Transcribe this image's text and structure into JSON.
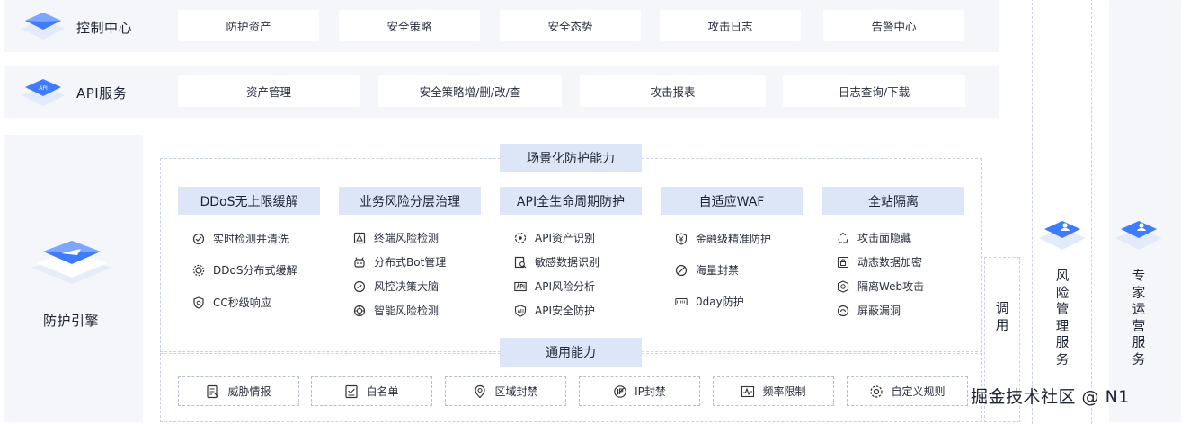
{
  "control_center": {
    "label": "控制中心",
    "items": [
      "防护资产",
      "安全策略",
      "安全态势",
      "攻击日志",
      "告警中心"
    ]
  },
  "api_service": {
    "label": "API服务",
    "cube_text": "API",
    "items": [
      "资产管理",
      "安全策略增/删/改/查",
      "攻击报表",
      "日志查询/下载"
    ]
  },
  "engine": {
    "label": "防护引擎"
  },
  "scenario": {
    "title": "场景化防护能力",
    "columns": [
      {
        "title": "DDoS无上限缓解",
        "items": [
          {
            "icon": "monitor-check-icon",
            "label": "实时检测并清洗"
          },
          {
            "icon": "gear-icon",
            "label": "DDoS分布式缓解"
          },
          {
            "icon": "shield-icon",
            "label": "CC秒级响应"
          }
        ]
      },
      {
        "title": "业务风险分层治理",
        "items": [
          {
            "icon": "warning-terminal-icon",
            "label": "终端风险检测"
          },
          {
            "icon": "bot-icon",
            "label": "分布式Bot管理"
          },
          {
            "icon": "brain-icon",
            "label": "风控决策大脑"
          },
          {
            "icon": "smart-detect-icon",
            "label": "智能风险检测"
          }
        ]
      },
      {
        "title": "API全生命周期防护",
        "items": [
          {
            "icon": "api-asset-icon",
            "label": "API资产识别"
          },
          {
            "icon": "data-scan-icon",
            "label": "敏感数据识别"
          },
          {
            "icon": "api-box-icon",
            "label": "API风险分析"
          },
          {
            "icon": "api-shield-icon",
            "label": "API安全防护"
          }
        ]
      },
      {
        "title": "自适应WAF",
        "items": [
          {
            "icon": "finance-shield-icon",
            "label": "金融级精准防护"
          },
          {
            "icon": "ban-icon",
            "label": "海量封禁"
          },
          {
            "icon": "zero-day-icon",
            "label": "0day防护"
          }
        ]
      },
      {
        "title": "全站隔离",
        "items": [
          {
            "icon": "recycle-icon",
            "label": "攻击面隐藏"
          },
          {
            "icon": "lock-doc-icon",
            "label": "动态数据加密"
          },
          {
            "icon": "isolate-icon",
            "label": "隔离Web攻击"
          },
          {
            "icon": "patch-icon",
            "label": "屏蔽漏洞"
          }
        ]
      }
    ]
  },
  "common": {
    "title": "通用能力",
    "items": [
      {
        "icon": "intel-icon",
        "label": "威胁情报"
      },
      {
        "icon": "whitelist-icon",
        "label": "白名单"
      },
      {
        "icon": "region-icon",
        "label": "区域封禁"
      },
      {
        "icon": "ip-icon",
        "label": "IP封禁"
      },
      {
        "icon": "rate-icon",
        "label": "频率限制"
      },
      {
        "icon": "custom-rule-icon",
        "label": "自定义规则"
      }
    ]
  },
  "side": {
    "call_label": "调用",
    "risk_service": "风险管理服务",
    "expert_service": "专家运营服务"
  },
  "watermark": "掘金技术社区 @ N1",
  "colors": {
    "accent": "#2f6bff",
    "header_fill": "#dde6f7",
    "band_fill": "#f4f6fa"
  }
}
